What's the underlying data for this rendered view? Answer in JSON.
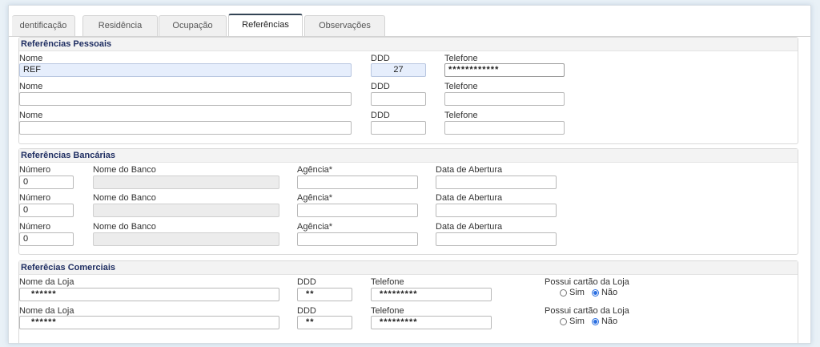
{
  "tabs": [
    {
      "label": "dentificação"
    },
    {
      "label": "Residência"
    },
    {
      "label": "Ocupação"
    },
    {
      "label": "Referências"
    },
    {
      "label": "Observações"
    }
  ],
  "pessoais": {
    "title": "Referências Pessoais",
    "rows": [
      {
        "nome_label": "Nome",
        "nome_value": "REF",
        "ddd_label": "DDD",
        "ddd_value": "27",
        "tel_label": "Telefone",
        "tel_value": "************"
      },
      {
        "nome_label": "Nome",
        "nome_value": "",
        "ddd_label": "DDD",
        "ddd_value": "",
        "tel_label": "Telefone",
        "tel_value": ""
      },
      {
        "nome_label": "Nome",
        "nome_value": "",
        "ddd_label": "DDD",
        "ddd_value": "",
        "tel_label": "Telefone",
        "tel_value": ""
      }
    ]
  },
  "bancarias": {
    "title": "Referências Bancárias",
    "rows": [
      {
        "numero_label": "Número",
        "numero_value": "0",
        "banco_label": "Nome do Banco",
        "banco_value": "",
        "agencia_label": "Agência*",
        "agencia_value": "",
        "data_label": "Data de Abertura",
        "data_value": ""
      },
      {
        "numero_label": "Número",
        "numero_value": "0",
        "banco_label": "Nome do Banco",
        "banco_value": "",
        "agencia_label": "Agência*",
        "agencia_value": "",
        "data_label": "Data de Abertura",
        "data_value": ""
      },
      {
        "numero_label": "Número",
        "numero_value": "0",
        "banco_label": "Nome do Banco",
        "banco_value": "",
        "agencia_label": "Agência*",
        "agencia_value": "",
        "data_label": "Data de Abertura",
        "data_value": ""
      }
    ]
  },
  "comerciais": {
    "title": "Referêcias Comerciais",
    "rows": [
      {
        "loja_label": "Nome da Loja",
        "loja_value": "******",
        "ddd_label": "DDD",
        "ddd_value": "**",
        "tel_label": "Telefone",
        "tel_value": "*********",
        "cartao_label": "Possui cartão da Loja",
        "sim_label": "Sim",
        "nao_label": "Não",
        "selected": "Não"
      },
      {
        "loja_label": "Nome da Loja",
        "loja_value": "******",
        "ddd_label": "DDD",
        "ddd_value": "**",
        "tel_label": "Telefone",
        "tel_value": "*********",
        "cartao_label": "Possui cartão da Loja",
        "sim_label": "Sim",
        "nao_label": "Não",
        "selected": "Não"
      }
    ]
  }
}
